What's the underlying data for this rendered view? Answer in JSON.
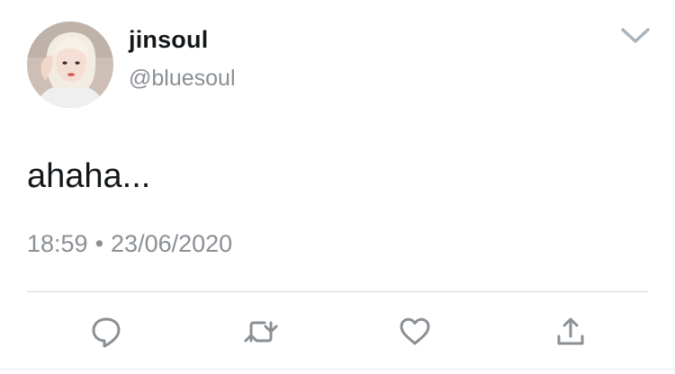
{
  "user": {
    "display_name": "jinsoul",
    "handle": "@bluesoul",
    "avatar_icon": "profile-photo"
  },
  "tweet": {
    "text": "ahaha...",
    "time": "18:59",
    "separator": "•",
    "date": "23/06/2020"
  },
  "actions": {
    "reply_icon": "reply-icon",
    "retweet_icon": "retweet-icon",
    "like_icon": "heart-icon",
    "share_icon": "share-icon"
  },
  "colors": {
    "text_primary": "#14171a",
    "text_secondary": "#8a8f94",
    "icon": "#8a8f94",
    "divider": "#cfd6dc"
  }
}
